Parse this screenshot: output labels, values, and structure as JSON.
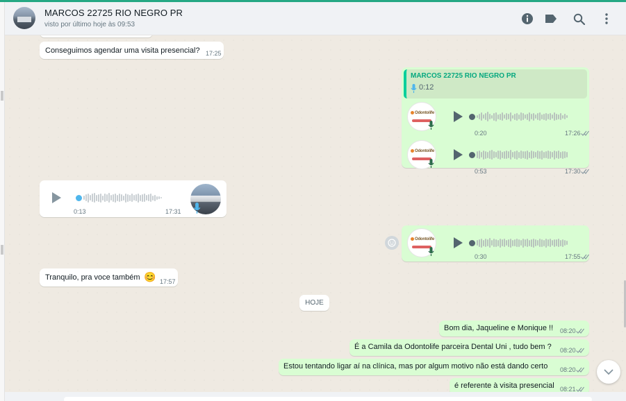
{
  "header": {
    "contact_name": "MARCOS 22725 RIO NEGRO PR",
    "status": "visto por último hoje às 09:53",
    "icons": [
      "info-icon",
      "label-icon",
      "search-icon",
      "menu-icon"
    ]
  },
  "messages": {
    "m1": {
      "text": "Conseguimos agendar uma visita presencial?",
      "time": "17:25"
    },
    "quoted": {
      "name": "MARCOS 22725 RIO NEGRO PR",
      "duration": "0:12"
    },
    "audio1": {
      "duration": "0:20",
      "time": "17:26"
    },
    "audio2": {
      "duration": "0:53",
      "time": "17:30"
    },
    "audio3": {
      "duration": "0:13",
      "time": "17:31"
    },
    "audio4": {
      "duration": "0:30",
      "time": "17:55"
    },
    "m2": {
      "text": "Tranquilo, pra voce também",
      "emoji": "😊",
      "time": "17:57"
    },
    "day_divider": "HOJE",
    "m3": {
      "text": "Bom dia, Jaqueline e Monique !!",
      "time": "08:20"
    },
    "m4": {
      "text": "É a Camila da Odontolife parceira Dental Uni , tudo bem ?",
      "time": "08:20"
    },
    "m5": {
      "text": "Estou tentando ligar aí na clínica, mas por algum motivo não está dando certo",
      "time": "08:20"
    },
    "m6": {
      "text": "é referente à visita presencial",
      "time": "08:21"
    }
  },
  "logo": {
    "text": "Odontolife"
  },
  "colors": {
    "accent": "#25a884",
    "incoming": "#ffffff",
    "outgoing": "#d9fdd3",
    "chat_bg": "#efeae2",
    "read_ticks": "#53bdeb",
    "audio_knob_in": "#4fb6ec"
  }
}
